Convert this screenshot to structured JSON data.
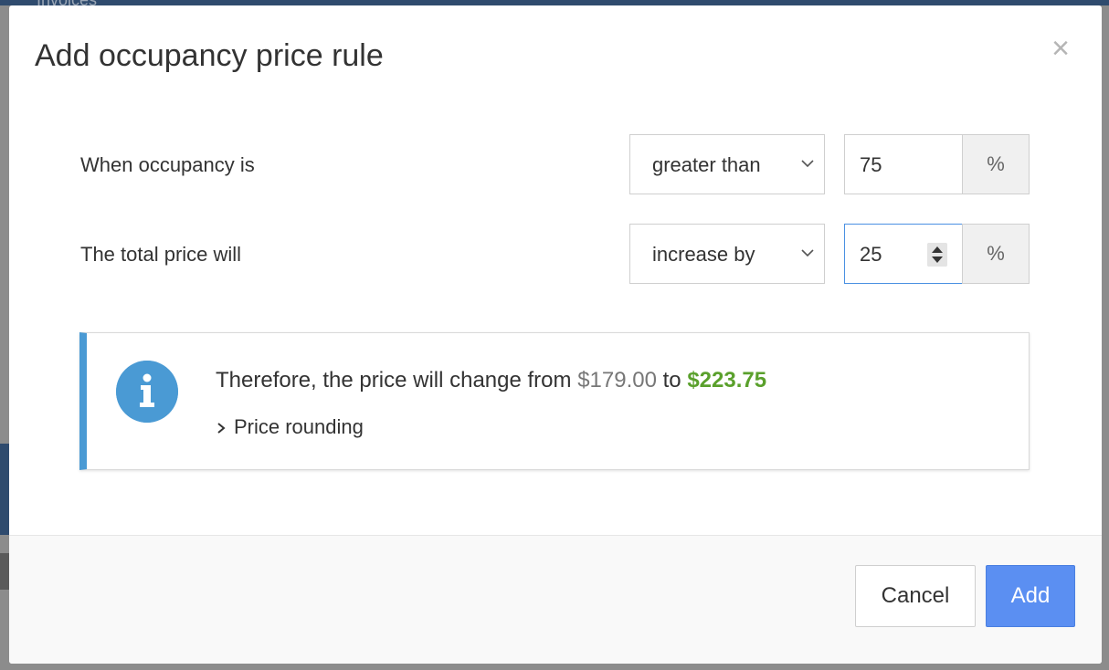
{
  "background": {
    "tab_label": "Invoices"
  },
  "modal": {
    "title": "Add occupancy price rule",
    "close_icon": "close-icon"
  },
  "rows": [
    {
      "label": "When occupancy is",
      "select_value": "greater than",
      "input_value": "75",
      "unit": "%"
    },
    {
      "label": "The total price will",
      "select_value": "increase by",
      "input_value": "25",
      "unit": "%"
    }
  ],
  "info": {
    "icon": "info-icon",
    "text_prefix": "Therefore, the price will change from",
    "old_price": "$179.00",
    "connector": "to",
    "new_price": "$223.75",
    "rounding_label": "Price rounding"
  },
  "footer": {
    "cancel_label": "Cancel",
    "add_label": "Add"
  },
  "colors": {
    "accent_blue": "#4a9ad4",
    "primary_button": "#5b8ff2",
    "new_price_green": "#5aa02c",
    "focus_border": "#4a90e2"
  }
}
